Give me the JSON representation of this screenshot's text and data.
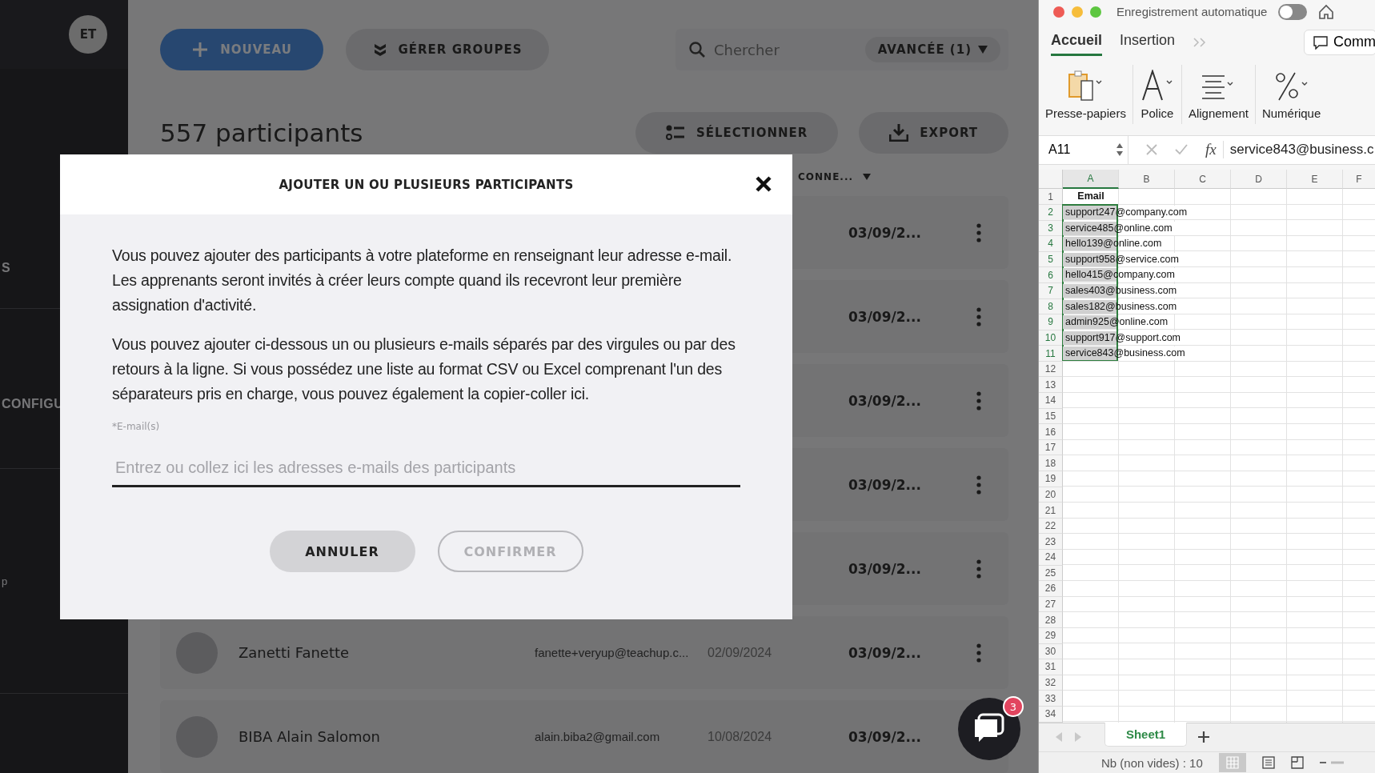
{
  "sidebar": {
    "avatar": "ET",
    "items": [
      {
        "label": "S"
      },
      {
        "label": "CONFIGU"
      },
      {
        "label": "p"
      }
    ]
  },
  "toolbar": {
    "new_button": "NOUVEAU",
    "groups_button": "GÉRER GROUPES",
    "search": {
      "placeholder": "Chercher"
    },
    "advanced_button": "AVANCÉE (1)"
  },
  "heading": {
    "title": "557 participants",
    "select_button": "SÉLECTIONNER",
    "export_button": "EXPORT"
  },
  "table": {
    "column_header": "CONNE...",
    "rows": [
      {
        "last_connection": "03/09/2..."
      },
      {
        "last_connection": "03/09/2..."
      },
      {
        "last_connection": "03/09/2..."
      },
      {
        "last_connection": "03/09/2..."
      },
      {
        "last_connection": "03/09/2..."
      },
      {
        "name": "Zanetti Fanette",
        "email": "fanette+veryup@teachup.c...",
        "date": "02/09/2024",
        "last_connection": "03/09/2..."
      },
      {
        "name": "BIBA Alain Salomon",
        "email": "alain.biba2@gmail.com",
        "date": "10/08/2024",
        "last_connection": "03/09/2..."
      }
    ]
  },
  "modal": {
    "title": "AJOUTER UN OU PLUSIEURS PARTICIPANTS",
    "paragraphs": [
      "Vous pouvez ajouter des participants à votre plateforme en renseignant leur adresse e-mail. Les apprenants seront invités à créer leurs compte quand ils recevront leur première assignation d'activité.",
      "Vous pouvez ajouter ci-dessous un ou plusieurs e-mails séparés par des virgules ou par des retours à la ligne. Si vous possédez une liste au format CSV ou Excel comprenant l'un des séparateurs pris en charge, vous pouvez également la copier-coller ici."
    ],
    "field_label": "*E-mail(s)",
    "placeholder": "Entrez ou collez ici les adresses e-mails des participants",
    "cancel_button": "ANNULER",
    "confirm_button": {
      "label": "CONFIRMER",
      "disabled": true
    }
  },
  "chat": {
    "badge": "3"
  },
  "excel": {
    "title": "Enregistrement automatique",
    "autosave": {
      "on": false
    },
    "tabs": [
      {
        "label": "Accueil",
        "selected": true
      },
      {
        "label": "Insertion",
        "selected": false
      }
    ],
    "comment_button": "Comm",
    "ribbon": [
      {
        "kind": "clipboard",
        "label": "Presse-papiers"
      },
      {
        "kind": "font",
        "label": "Police"
      },
      {
        "kind": "align",
        "label": "Alignement"
      },
      {
        "kind": "number",
        "label": "Numérique"
      }
    ],
    "name_box": "A11",
    "function_label": "fx",
    "formula": "service843@business.c",
    "columns": [
      {
        "label": "A",
        "selected": true
      },
      {
        "label": "B",
        "selected": false
      },
      {
        "label": "C",
        "selected": false
      },
      {
        "label": "D",
        "selected": false
      },
      {
        "label": "E",
        "selected": false
      },
      {
        "label": "F",
        "selected": false
      }
    ],
    "rows": [
      {
        "number": "1",
        "value": "Email",
        "selected": false
      },
      {
        "number": "2",
        "value": "support247@company.com",
        "selected": true
      },
      {
        "number": "3",
        "value": "service485@online.com",
        "selected": true
      },
      {
        "number": "4",
        "value": "hello139@online.com",
        "selected": true
      },
      {
        "number": "5",
        "value": "support958@service.com",
        "selected": true
      },
      {
        "number": "6",
        "value": "hello415@company.com",
        "selected": true
      },
      {
        "number": "7",
        "value": "sales403@business.com",
        "selected": true
      },
      {
        "number": "8",
        "value": "sales182@business.com",
        "selected": true
      },
      {
        "number": "9",
        "value": "admin925@online.com",
        "selected": true
      },
      {
        "number": "10",
        "value": "support917@support.com",
        "selected": true
      },
      {
        "number": "11",
        "value": "service843@business.com",
        "selected": true
      },
      {
        "number": "12",
        "selected": false
      },
      {
        "number": "13",
        "selected": false
      },
      {
        "number": "14",
        "selected": false
      },
      {
        "number": "15",
        "selected": false
      },
      {
        "number": "16",
        "selected": false
      },
      {
        "number": "17",
        "selected": false
      },
      {
        "number": "18",
        "selected": false
      },
      {
        "number": "19",
        "selected": false
      },
      {
        "number": "20",
        "selected": false
      },
      {
        "number": "21",
        "selected": false
      },
      {
        "number": "22",
        "selected": false
      },
      {
        "number": "23",
        "selected": false
      },
      {
        "number": "24",
        "selected": false
      },
      {
        "number": "25",
        "selected": false
      },
      {
        "number": "26",
        "selected": false
      },
      {
        "number": "27",
        "selected": false
      },
      {
        "number": "28",
        "selected": false
      },
      {
        "number": "29",
        "selected": false
      },
      {
        "number": "30",
        "selected": false
      },
      {
        "number": "31",
        "selected": false
      },
      {
        "number": "32",
        "selected": false
      },
      {
        "number": "33",
        "selected": false
      },
      {
        "number": "34",
        "selected": false
      }
    ],
    "sheets": [
      {
        "label": "Sheet1",
        "selected": true
      }
    ],
    "status": "Nb (non vides) : 10"
  }
}
